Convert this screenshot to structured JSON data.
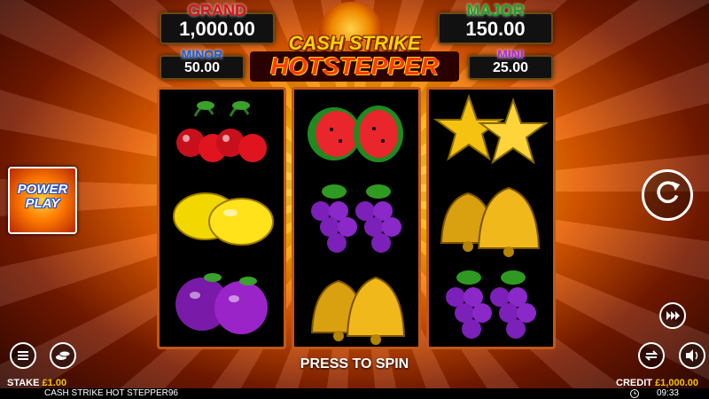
{
  "jackpots": {
    "grand": {
      "label": "GRAND",
      "value": "1,000.00"
    },
    "major": {
      "label": "MAJOR",
      "value": "150.00"
    },
    "minor": {
      "label": "MINOR",
      "value": "50.00"
    },
    "mini": {
      "label": "MINI",
      "value": "25.00"
    }
  },
  "logo": {
    "line1": "CASH STRIKE",
    "line2": "HOTSTEPPER"
  },
  "reels": [
    [
      "cherries",
      "lemons",
      "plums"
    ],
    [
      "watermelons",
      "grapes",
      "bells"
    ],
    [
      "stars",
      "bells",
      "grapes"
    ]
  ],
  "power_play": {
    "line1": "POWER",
    "line2": "PLAY"
  },
  "press_to_spin": "PRESS TO SPIN",
  "stake": {
    "label": "STAKE",
    "value": "£1.00"
  },
  "credit": {
    "label": "CREDIT",
    "value": "£1,000.00"
  },
  "footer": {
    "game_title": "CASH STRIKE HOT STEPPER96",
    "time": "09:33"
  },
  "icons": {
    "spin": "spin-icon",
    "menu": "menu-icon",
    "coins": "coins-icon",
    "autoplay": "autoplay-icon",
    "turbo": "turbo-icon",
    "sound": "speaker-icon",
    "clock": "clock-icon"
  }
}
